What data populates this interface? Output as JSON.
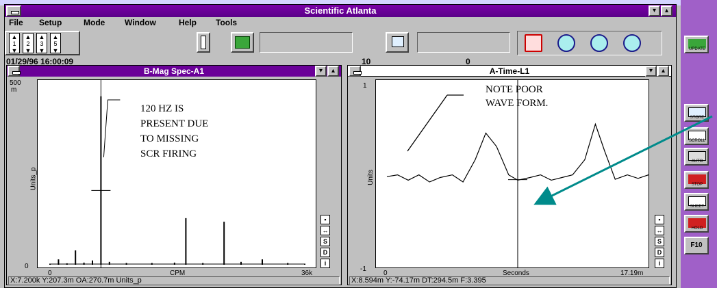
{
  "window": {
    "title": "Scientific Atlanta"
  },
  "menu": [
    "File",
    "Setup",
    "Mode",
    "Window",
    "Help",
    "Tools"
  ],
  "toolbar": {
    "channel_buttons": [
      "1",
      "2",
      "3",
      "5"
    ],
    "button_labels": [
      "UPDATE",
      "STORE"
    ],
    "zoom_buttons": [
      "marker-icon",
      "zoom-fit-icon",
      "zoom-horizontal-icon",
      "zoom-out-icon"
    ]
  },
  "status": {
    "datetime": "01/29/96 16:00:09",
    "value1": "10",
    "value2": "0"
  },
  "spectrum_window": {
    "title": "B-Mag Spec-A1",
    "y_top_label": "500",
    "y_top_unit": "m",
    "y_zero_label": "0",
    "ylabel": "Units_p",
    "x_start_label": "0",
    "xlabel": "CPM",
    "x_end_label": "36k",
    "annotation_lines": [
      "120 HZ IS",
      "PRESENT DUE",
      "TO  MISSING",
      "SCR FIRING"
    ],
    "readout": "X:7.200k  Y:207.3m  OA:270.7m  Units_p",
    "side_buttons": [
      "S",
      "D",
      "i"
    ]
  },
  "time_window": {
    "title": "A-Time-L1",
    "y_top_label": "1",
    "y_bottom_label": "-1",
    "ylabel": "Units",
    "x_start_label": "0",
    "xlabel": "Seconds",
    "x_end_label": "17.19m",
    "annotation_lines": [
      "NOTE POOR",
      "WAVE FORM."
    ],
    "readout": "X:8.594m  Y:-74.17m  DT:294.5m  F:3.395",
    "side_buttons": [
      "S",
      "D",
      "i"
    ]
  },
  "palette": [
    "UPDATE",
    "STORE",
    "SCROLL",
    "AUTO",
    "STOP",
    "SHEET",
    "HOLD",
    "F10"
  ],
  "colors": {
    "title_active": "#6a0098",
    "title_inactive": "#ffffff",
    "palette_bg": "#a060c8",
    "arrow": "#008b8b"
  },
  "chart_data": [
    {
      "type": "line",
      "title": "B-Mag Spec-A1",
      "xlabel": "CPM",
      "ylabel": "Units_p",
      "xlim": [
        0,
        36000
      ],
      "ylim": [
        0,
        500
      ],
      "x": [
        0,
        1200,
        2400,
        3600,
        4800,
        6000,
        7200,
        8400,
        10800,
        14400,
        17600,
        19200,
        21600,
        24600,
        27000,
        30000,
        33600,
        36000
      ],
      "y": [
        3,
        15,
        4,
        40,
        6,
        12,
        470,
        8,
        5,
        5,
        6,
        130,
        5,
        120,
        8,
        15,
        5,
        3
      ]
    },
    {
      "type": "line",
      "title": "A-Time-L1",
      "xlabel": "Seconds",
      "ylabel": "Units",
      "xlim": [
        0,
        17.19
      ],
      "ylim": [
        -1,
        1
      ],
      "x": [
        0,
        0.7,
        1.4,
        2.1,
        2.8,
        3.5,
        4.3,
        5.0,
        5.8,
        6.5,
        7.2,
        8.0,
        8.6,
        9.4,
        10.1,
        10.8,
        11.5,
        12.2,
        13.0,
        13.7,
        14.3,
        15.0,
        15.8,
        16.5,
        17.19
      ],
      "y": [
        -0.04,
        -0.02,
        -0.08,
        -0.02,
        -0.1,
        -0.05,
        -0.02,
        -0.1,
        0.15,
        0.45,
        0.3,
        -0.02,
        -0.08,
        -0.05,
        -0.02,
        -0.08,
        -0.05,
        -0.02,
        0.15,
        0.55,
        0.25,
        -0.07,
        -0.02,
        -0.06,
        -0.02
      ]
    }
  ]
}
